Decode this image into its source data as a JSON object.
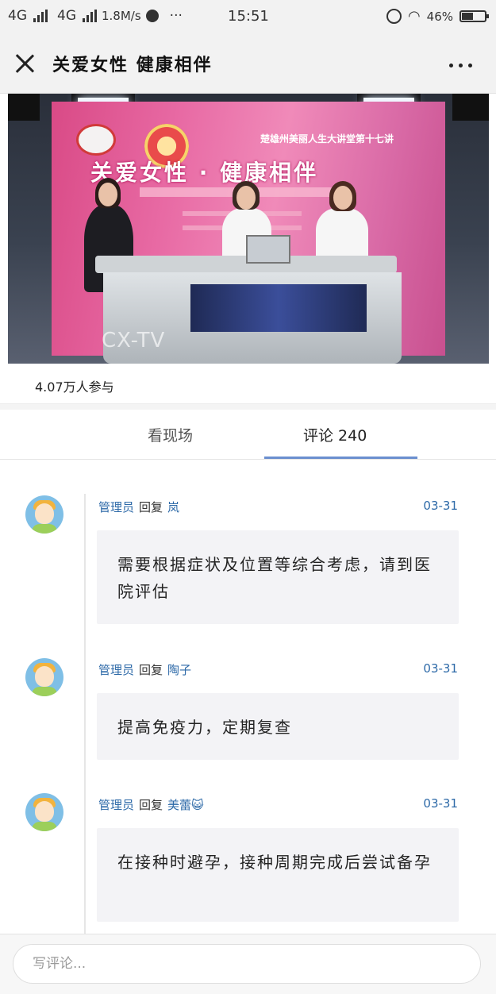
{
  "status_bar": {
    "network1": "4G",
    "network2": "4G",
    "speed": "1.8M/s",
    "dots": "···",
    "time": "15:51",
    "battery": "46%",
    "battery_level": 0.46
  },
  "nav": {
    "title": "关爱女性 健康相伴",
    "more": "···"
  },
  "video": {
    "screen_subtitle": "楚雄州美丽人生大讲堂第十七讲",
    "screen_title": "关爱女性 · 健康相伴",
    "watermark": "CX-TV"
  },
  "participants": "4.07万人参与",
  "tabs": [
    {
      "label": "看现场"
    },
    {
      "label": "评论 240"
    }
  ],
  "comments": [
    {
      "author": "管理员",
      "reply_word": "回复",
      "reply_to": "岚",
      "date": "03-31",
      "text": "需要根据症状及位置等综合考虑，请到医院评估"
    },
    {
      "author": "管理员",
      "reply_word": "回复",
      "reply_to": "陶子",
      "date": "03-31",
      "text": "提高免疫力，定期复查"
    },
    {
      "author": "管理员",
      "reply_word": "回复",
      "reply_to": "美蕾😺",
      "date": "03-31",
      "text": "在接种时避孕，接种周期完成后尝试备孕"
    }
  ],
  "footer": {
    "input_placeholder": "写评论..."
  }
}
